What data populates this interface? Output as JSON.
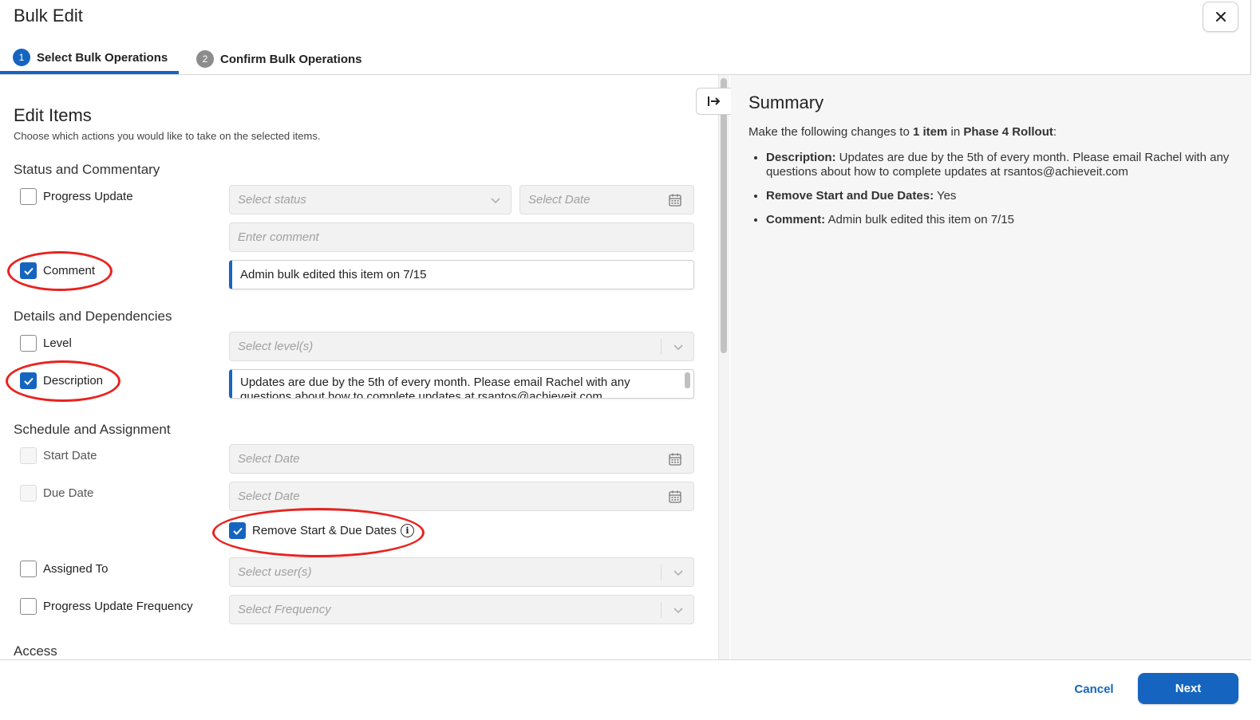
{
  "modal": {
    "title": "Bulk Edit",
    "close_icon": "close-icon"
  },
  "steps": [
    {
      "number": "1",
      "label": "Select Bulk Operations",
      "active": true
    },
    {
      "number": "2",
      "label": "Confirm Bulk Operations",
      "active": false
    }
  ],
  "edit": {
    "title": "Edit Items",
    "subtitle": "Choose which actions you would like to take on the selected items."
  },
  "sections": {
    "status": "Status and Commentary",
    "details": "Details and Dependencies",
    "schedule": "Schedule and Assignment",
    "access": "Access"
  },
  "fields": {
    "progress_update": {
      "label": "Progress Update",
      "checked": false,
      "status_placeholder": "Select status",
      "date_placeholder": "Select Date",
      "comment_placeholder": "Enter comment"
    },
    "comment": {
      "label": "Comment",
      "checked": true,
      "value": "Admin bulk edited this item on 7/15"
    },
    "level": {
      "label": "Level",
      "checked": false,
      "placeholder": "Select level(s)"
    },
    "description": {
      "label": "Description",
      "checked": true,
      "value": "Updates are due by the 5th of every month. Please email Rachel with any questions about how to complete updates at rsantos@achieveit.com"
    },
    "start_date": {
      "label": "Start Date",
      "checked": false,
      "disabled": true,
      "placeholder": "Select Date"
    },
    "due_date": {
      "label": "Due Date",
      "checked": false,
      "disabled": true,
      "placeholder": "Select Date"
    },
    "remove_dates": {
      "label": "Remove Start & Due Dates",
      "checked": true,
      "info_icon": "info-icon"
    },
    "assigned_to": {
      "label": "Assigned To",
      "checked": false,
      "placeholder": "Select user(s)"
    },
    "frequency": {
      "label": "Progress Update Frequency",
      "checked": false,
      "placeholder": "Select Frequency"
    }
  },
  "summary": {
    "title": "Summary",
    "intro_prefix": "Make the following changes to ",
    "intro_count": "1 item",
    "intro_mid": " in ",
    "intro_plan": "Phase 4 Rollout",
    "intro_suffix": ":",
    "items": [
      {
        "key": "Description:",
        "value": " Updates are due by the 5th of every month. Please email Rachel with any questions about how to complete updates at rsantos@achieveit.com"
      },
      {
        "key": "Remove Start and Due Dates:",
        "value": " Yes"
      },
      {
        "key": "Comment:",
        "value": " Admin bulk edited this item on 7/15"
      }
    ]
  },
  "footer": {
    "cancel_label": "Cancel",
    "next_label": "Next"
  },
  "colors": {
    "accent": "#1565c0",
    "annotation": "#e8231f"
  }
}
